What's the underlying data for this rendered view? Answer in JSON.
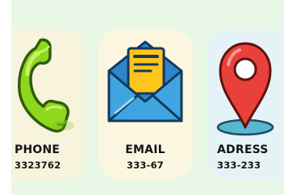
{
  "cards": [
    {
      "icon": "phone-handset-icon",
      "title": "PHONE",
      "value": "3323762"
    },
    {
      "icon": "envelope-letter-icon",
      "title": "EMAIL",
      "value": "333-67"
    },
    {
      "icon": "map-pin-icon",
      "title": "ADRESS",
      "value": "333-233"
    }
  ],
  "colors": {
    "background_strip": "#e8f7e6",
    "phone_card": "#f7f3dc",
    "email_card": "#fbf6e0",
    "address_card": "#e5f3f6",
    "phone_green": "#8ed81c",
    "envelope_blue": "#3fa5e0",
    "letter_yellow": "#ffc51a",
    "pin_red": "#e8403a"
  }
}
